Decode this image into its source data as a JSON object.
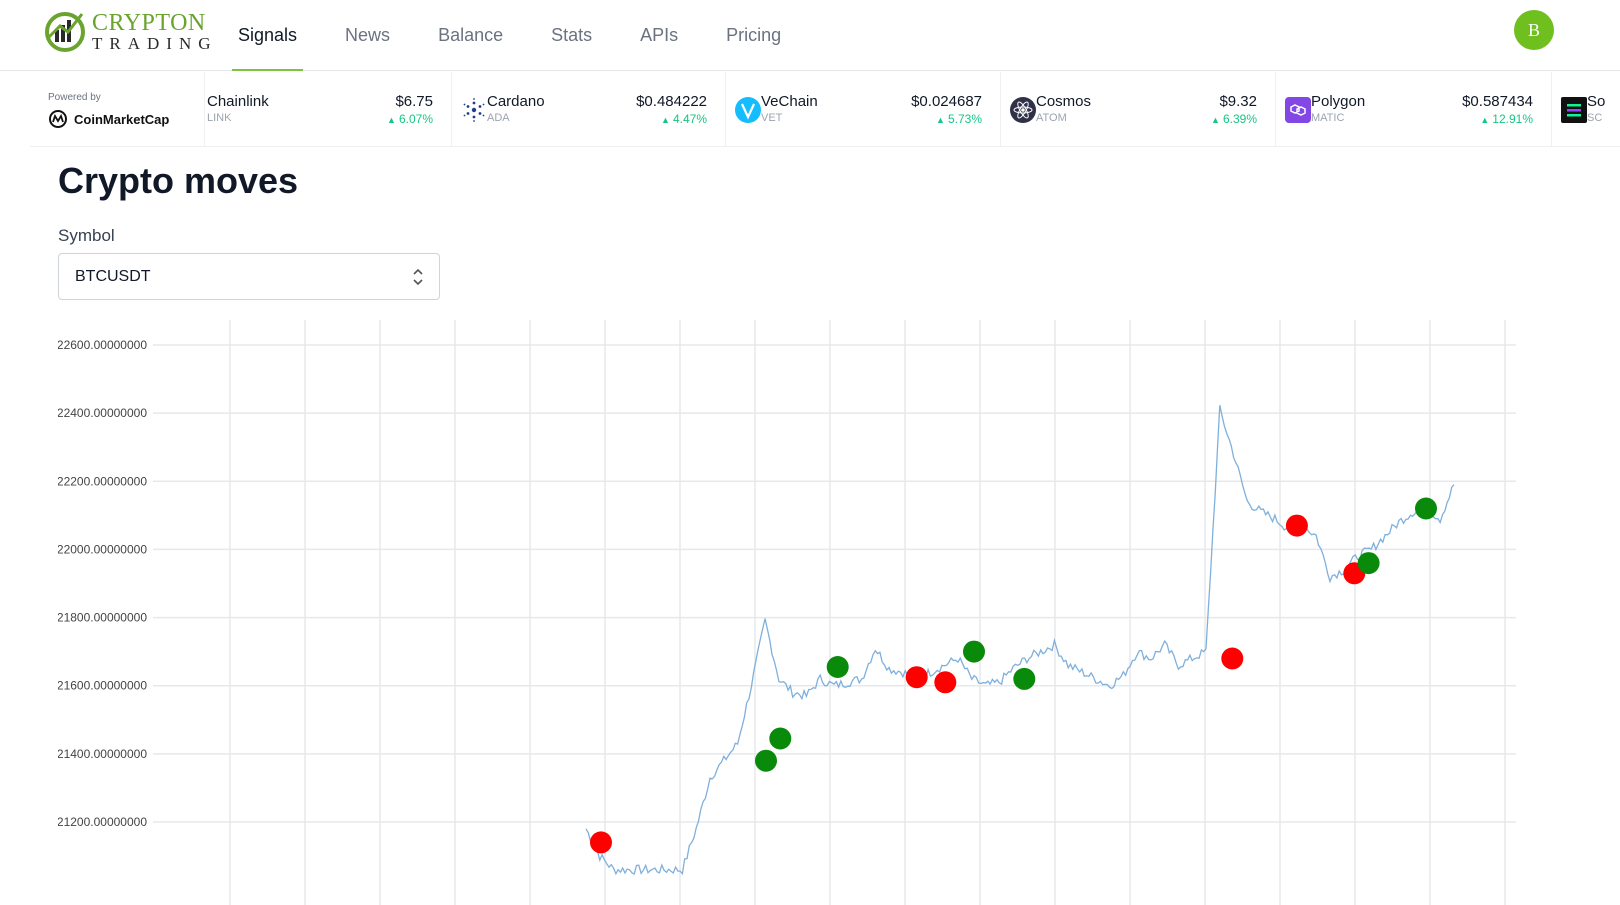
{
  "app": {
    "logo_text_top": "CRYPTON",
    "logo_text_bottom": "TRADING",
    "brand_color": "#6aa42f"
  },
  "nav": {
    "items": [
      {
        "label": "Signals",
        "active": true
      },
      {
        "label": "News",
        "active": false
      },
      {
        "label": "Balance",
        "active": false
      },
      {
        "label": "Stats",
        "active": false
      },
      {
        "label": "APIs",
        "active": false
      },
      {
        "label": "Pricing",
        "active": false
      }
    ],
    "avatar_initial": "B",
    "avatar_color": "#6fbf1f"
  },
  "ticker": {
    "powered_by": "Powered by",
    "provider": "CoinMarketCap",
    "up_color": "#16c784",
    "coins": [
      {
        "name": "Chainlink",
        "symbol": "LINK",
        "price": "$6.75",
        "change": "6.07%",
        "icon": "chainlink-icon"
      },
      {
        "name": "Cardano",
        "symbol": "ADA",
        "price": "$0.484222",
        "change": "4.47%",
        "icon": "cardano-icon"
      },
      {
        "name": "VeChain",
        "symbol": "VET",
        "price": "$0.024687",
        "change": "5.73%",
        "icon": "vechain-icon"
      },
      {
        "name": "Cosmos",
        "symbol": "ATOM",
        "price": "$9.32",
        "change": "6.39%",
        "icon": "cosmos-icon"
      },
      {
        "name": "Polygon",
        "symbol": "MATIC",
        "price": "$0.587434",
        "change": "12.91%",
        "icon": "polygon-icon"
      },
      {
        "name": "So",
        "symbol": "SC",
        "price": "",
        "change": "",
        "icon": "solana-icon"
      }
    ]
  },
  "main": {
    "title": "Crypto moves",
    "symbol_label": "Symbol",
    "symbol_value": "BTCUSDT"
  },
  "chart_data": {
    "type": "line",
    "title": "",
    "xlabel": "",
    "ylabel": "",
    "ylim": [
      21060,
      22710
    ],
    "y_ticks": [
      "22600.00000000",
      "22400.00000000",
      "22200.00000000",
      "22000.00000000",
      "21800.00000000",
      "21600.00000000",
      "21400.00000000",
      "21200.00000000"
    ],
    "y_tick_values": [
      22600,
      22400,
      22200,
      22000,
      21800,
      21600,
      21400,
      21200
    ],
    "grid": true,
    "line_color": "#7fb0dc",
    "buy_color": "#0a8a0a",
    "sell_color": "#ff0000",
    "x": [
      0,
      0.4,
      0.8,
      1.0,
      1.2,
      1.6,
      2.0,
      2.4,
      2.7,
      2.9,
      3.1,
      3.3,
      3.6,
      3.9,
      4.2,
      4.5,
      4.8,
      5.2,
      5.6,
      6.0,
      6.4,
      6.8,
      7.2,
      7.6,
      8.0,
      8.4,
      8.8,
      9.2,
      9.6,
      10.0,
      10.4,
      10.8,
      11.2,
      11.6,
      12.0,
      12.4,
      12.8,
      13.2,
      13.6,
      13.9,
      14.1,
      14.2,
      14.4,
      14.8,
      15.2,
      15.6,
      15.9,
      16.0,
      16.2,
      16.6,
      17.0,
      17.4,
      17.8,
      18.2,
      18.6,
      19.0,
      19.4,
      19.6
    ],
    "series": [
      {
        "name": "",
        "values": [
          21180,
          21100,
          21060,
          21060,
          21060,
          21060,
          21060,
          21060,
          21180,
          21330,
          21380,
          21430,
          21600,
          21790,
          21620,
          21580,
          21570,
          21620,
          21600,
          21610,
          21620,
          21710,
          21650,
          21640,
          21620,
          21640,
          21660,
          21680,
          21620,
          21600,
          21610,
          21650,
          21680,
          21700,
          21720,
          21660,
          21640,
          21620,
          21600,
          21630,
          21700,
          21680,
          21720,
          21660,
          21680,
          21700,
          22410,
          22280,
          22140,
          22110,
          22090,
          22060,
          22070,
          22040,
          21920,
          21940,
          21980,
          22000,
          22040,
          22080,
          22110,
          22120,
          22090,
          22190
        ]
      }
    ],
    "markers": [
      {
        "x": 2.0,
        "y": 21140,
        "type": "sell"
      },
      {
        "x": 4.3,
        "y": 21380,
        "type": "buy"
      },
      {
        "x": 4.5,
        "y": 21445,
        "type": "buy"
      },
      {
        "x": 5.3,
        "y": 21655,
        "type": "buy"
      },
      {
        "x": 6.4,
        "y": 21625,
        "type": "sell"
      },
      {
        "x": 6.8,
        "y": 21610,
        "type": "sell"
      },
      {
        "x": 7.2,
        "y": 21700,
        "type": "buy"
      },
      {
        "x": 7.9,
        "y": 21620,
        "type": "buy"
      },
      {
        "x": 10.8,
        "y": 21680,
        "type": "sell"
      },
      {
        "x": 11.7,
        "y": 22070,
        "type": "sell"
      },
      {
        "x": 12.5,
        "y": 21930,
        "type": "sell"
      },
      {
        "x": 12.7,
        "y": 21960,
        "type": "buy"
      },
      {
        "x": 13.5,
        "y": 22120,
        "type": "buy"
      }
    ]
  }
}
